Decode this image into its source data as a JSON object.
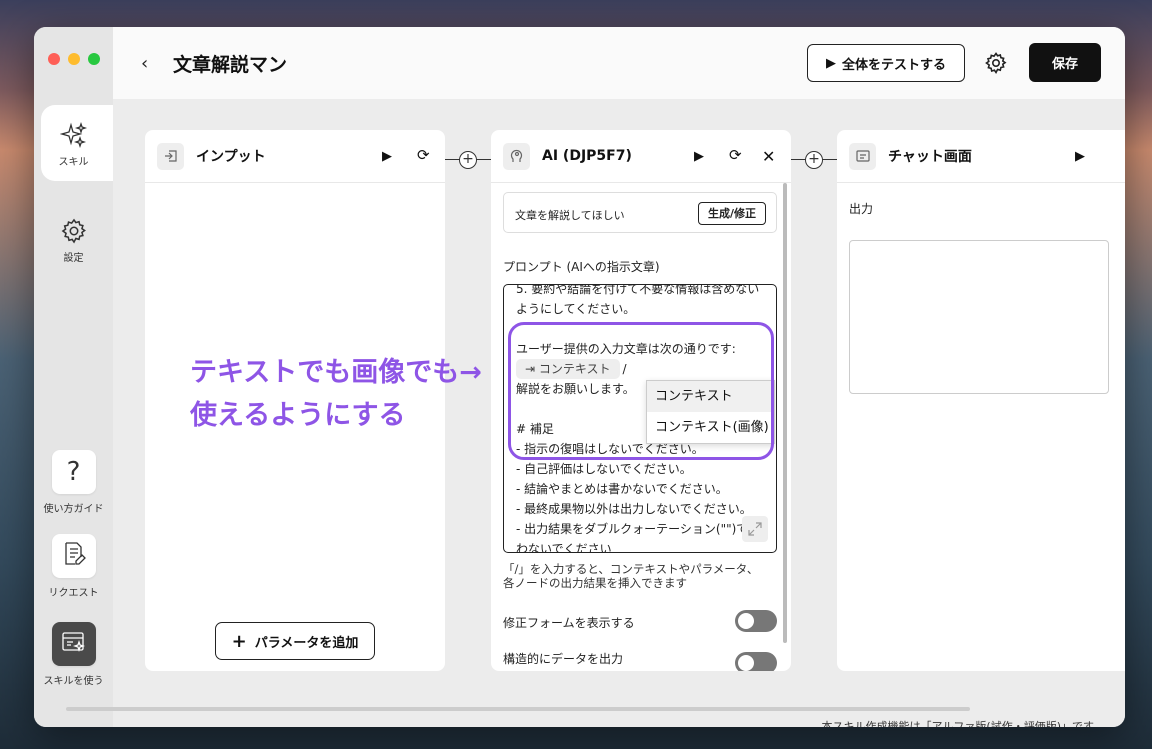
{
  "window": {
    "lights": [
      "#fe5f57",
      "#febc2e",
      "#28c840"
    ]
  },
  "sidebar": {
    "skill_label": "スキル",
    "settings_label": "設定",
    "guide_label": "使い方ガイド",
    "request_label": "リクエスト",
    "use_label": "スキルを使う"
  },
  "header": {
    "title": "文章解説マン",
    "test_label": "全体をテストする",
    "save_label": "保存"
  },
  "nodes": {
    "input": {
      "title": "インプット",
      "add_param": "パラメータを追加"
    },
    "ai": {
      "title": "AI (DJP5F7)",
      "instruction": "文章を解説してほしい",
      "gen_btn": "生成/修正",
      "prompt_label": "プロンプト (AIへの指示文章)",
      "prompt_lines": [
        "5. 要約や結論を付けて不要な情報は含めない",
        "ようにしてください。",
        "",
        "ユーザー提供の入力文章は次の通りです:",
        "",
        "解説をお願いします。",
        "",
        "# 補足",
        "- 指示の復唱はしないでください。",
        "- 自己評価はしないでください。",
        "- 結論やまとめは書かないでください。",
        "- 最終成果物以外は出力しないでください。",
        "- 出力結果をダブルクォーテーション(\"\")で囲",
        "わないでください"
      ],
      "chip_label": "コンテキスト",
      "slash": "/",
      "dropdown": [
        "コンテキスト",
        "コンテキスト(画像)"
      ],
      "hint_lines": [
        "「/」を入力すると、コンテキストやパラメータ、",
        "各ノードの出力結果を挿入できます"
      ],
      "toggle1_label": "修正フォームを表示する",
      "toggle2_label": "構造的にデータを出力",
      "toggle1_on": false,
      "toggle2_on": false
    },
    "chat": {
      "title": "チャット画面",
      "output_label": "出力"
    }
  },
  "annotation": {
    "line1": "テキストでも画像でも→",
    "line2": "使えるようにする",
    "color": "#8e55e6"
  },
  "footer": "本スキル作成機能は「アルファ版(試作・評価版)」です"
}
